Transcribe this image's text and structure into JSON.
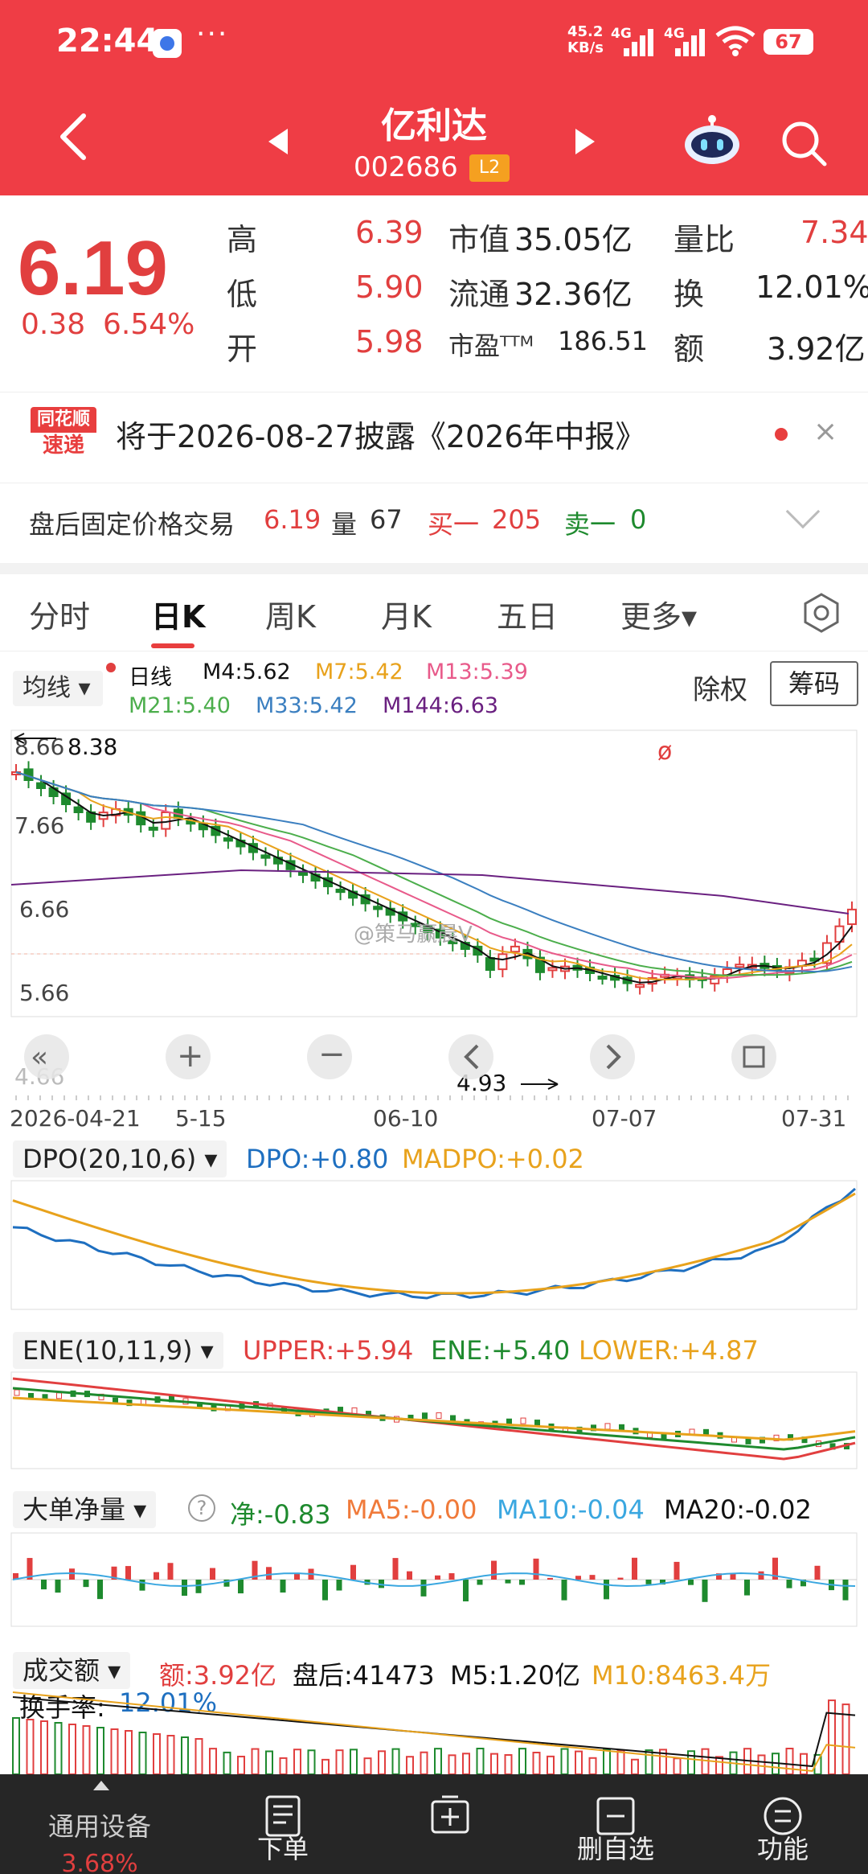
{
  "status": {
    "time": "22:44",
    "more": "···",
    "net_speed_top": "45.2",
    "net_speed_bottom": "KB/s",
    "sig1": "4G",
    "sig2": "4G",
    "battery": "67"
  },
  "header": {
    "name": "亿利达",
    "code": "002686",
    "level": "L2"
  },
  "quote": {
    "price": "6.19",
    "change": "0.38",
    "change_pct": "6.54%",
    "high_label": "高",
    "high": "6.39",
    "low_label": "低",
    "low": "5.90",
    "open_label": "开",
    "open": "5.98",
    "mcap_label": "市值",
    "mcap": "35.05亿",
    "float_label": "流通",
    "float": "32.36亿",
    "pe_label": "市盈ᵀᵀᴹ",
    "pe": "186.51",
    "vr_label": "量比",
    "vr": "7.34",
    "turn_label": "换",
    "turn": "12.01%",
    "amt_label": "额",
    "amt": "3.92亿"
  },
  "notice": {
    "logo_top": "同花顺",
    "logo_bottom": "速递",
    "text": "将于2026-08-27披露《2026年中报》",
    "close": "×"
  },
  "after_hours": {
    "label": "盘后固定价格交易",
    "price": "6.19",
    "vol_label": "量",
    "vol": "67",
    "buy_label": "买一",
    "buy": "205",
    "sell_label": "卖一",
    "sell": "0"
  },
  "tabs": [
    "分时",
    "日K",
    "周K",
    "月K",
    "五日",
    "更多▾"
  ],
  "ma_legend": {
    "selector": "均线 ▾",
    "period": "日线",
    "m4": "M4:5.62",
    "m7": "M7:5.42",
    "m13": "M13:5.39",
    "m21": "M21:5.40",
    "m33": "M33:5.42",
    "m144": "M144:6.63",
    "exright": "除权",
    "chips": "筹码"
  },
  "kline": {
    "max_label": "8.38",
    "min_label": "4.93",
    "y_labels": [
      "8.66",
      "7.66",
      "6.66",
      "5.66",
      "4.66"
    ],
    "x_labels": [
      "2026-04-21",
      "5-15",
      "06-10",
      "07-07",
      "07-31"
    ],
    "watermark": "@策马赢晨V"
  },
  "dpo": {
    "selector": "DPO(20,10,6) ▾",
    "dpo": "DPO:+0.80",
    "madpo": "MADPO:+0.02"
  },
  "ene": {
    "selector": "ENE(10,11,9) ▾",
    "upper": "UPPER:+5.94",
    "ene": "ENE:+5.40",
    "lower": "LOWER:+4.87"
  },
  "bigorder": {
    "selector": "大单净量 ▾",
    "help": "?",
    "net": "净:-0.83",
    "ma5": "MA5:-0.00",
    "ma10": "MA10:-0.04",
    "ma20": "MA20:-0.02"
  },
  "turnover": {
    "selector": "成交额 ▾",
    "amt": "额:3.92亿",
    "after": "盘后:41473",
    "m5": "M5:1.20亿",
    "m10": "M10:8463.4万",
    "rate_label": "换手率:",
    "rate": "12.01%"
  },
  "bottom_nav": {
    "general": "通用设备",
    "general_pct": "3.68%",
    "order": "下单",
    "add": "",
    "remove": "删自选",
    "func": "功能"
  },
  "colors": {
    "up": "#e13f3f",
    "down": "#1e8a2e",
    "brand": "#ef3d45",
    "m4": "#111111",
    "m7": "#e8a21c",
    "m13": "#e85a8a",
    "m21": "#4cae4c",
    "m33": "#3b7fc0",
    "m144": "#6a2080"
  }
}
